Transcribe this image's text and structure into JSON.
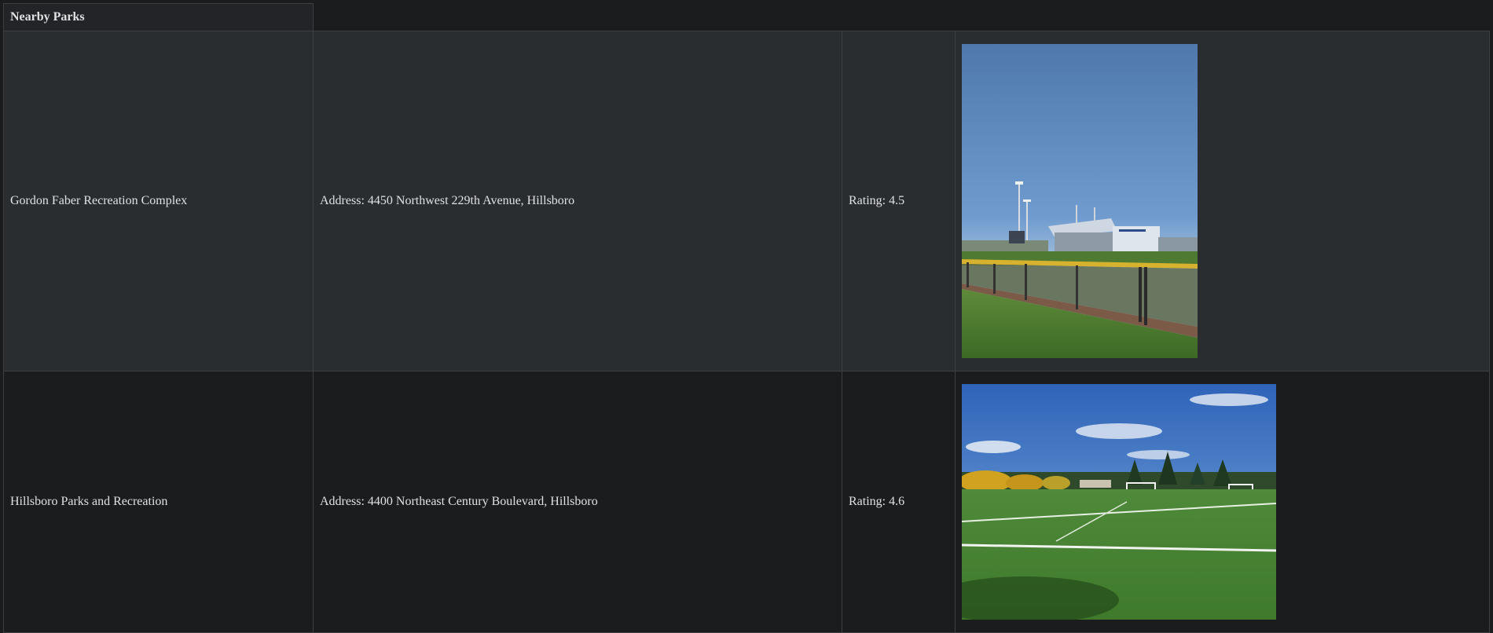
{
  "table": {
    "title": "Nearby Parks",
    "rows": [
      {
        "name": "Gordon Faber Recreation Complex",
        "address": "Address: 4450 Northwest 229th Avenue, Hillsboro",
        "rating": "Rating: 4.5",
        "photo_icon": "stadium-photo"
      },
      {
        "name": "Hillsboro Parks and Recreation",
        "address": "Address: 4400 Northeast Century Boulevard, Hillsboro",
        "rating": "Rating: 4.6",
        "photo_icon": "soccer-field-photo"
      }
    ]
  },
  "colors": {
    "background": "#1b1c1e",
    "row_alt": "#2a2d30",
    "border": "#3d4043",
    "text": "#dfe1e3"
  }
}
